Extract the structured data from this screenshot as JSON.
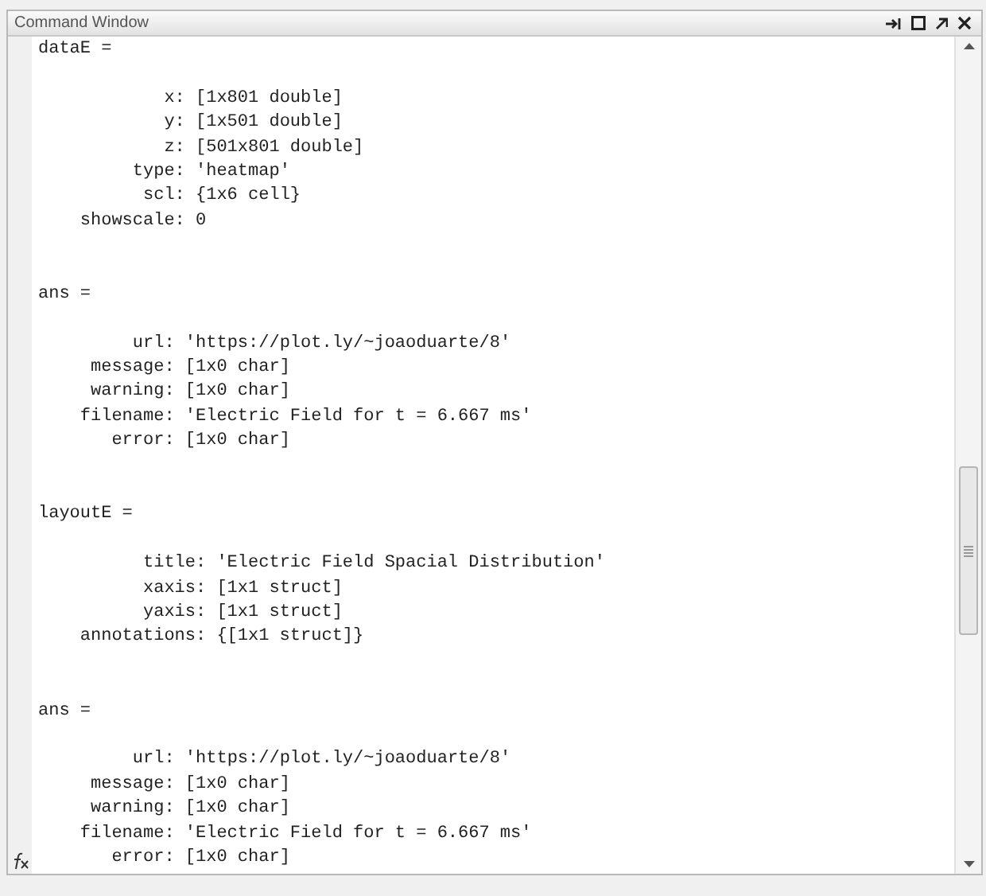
{
  "window": {
    "title": "Command Window"
  },
  "output": [
    {
      "variable": "dataE =",
      "fields": [
        {
          "name": "x:",
          "value": "[1x801 double]"
        },
        {
          "name": "y:",
          "value": "[1x501 double]"
        },
        {
          "name": "z:",
          "value": "[501x801 double]"
        },
        {
          "name": "type:",
          "value": "'heatmap'"
        },
        {
          "name": "scl:",
          "value": "{1x6 cell}"
        },
        {
          "name": "showscale:",
          "value": "0"
        }
      ]
    },
    {
      "variable": "ans =",
      "fields": [
        {
          "name": "url:",
          "value": "'https://plot.ly/~joaoduarte/8'"
        },
        {
          "name": "message:",
          "value": "[1x0 char]"
        },
        {
          "name": "warning:",
          "value": "[1x0 char]"
        },
        {
          "name": "filename:",
          "value": "'Electric Field for t = 6.667 ms'"
        },
        {
          "name": "error:",
          "value": "[1x0 char]"
        }
      ]
    },
    {
      "variable": "layoutE =",
      "fields": [
        {
          "name": "title:",
          "value": "'Electric Field Spacial Distribution'"
        },
        {
          "name": "xaxis:",
          "value": "[1x1 struct]"
        },
        {
          "name": "yaxis:",
          "value": "[1x1 struct]"
        },
        {
          "name": "annotations:",
          "value": "{[1x1 struct]}"
        }
      ]
    },
    {
      "variable": "ans =",
      "fields": [
        {
          "name": "url:",
          "value": "'https://plot.ly/~joaoduarte/8'"
        },
        {
          "name": "message:",
          "value": "[1x0 char]"
        },
        {
          "name": "warning:",
          "value": "[1x0 char]"
        },
        {
          "name": "filename:",
          "value": "'Electric Field for t = 6.667 ms'"
        },
        {
          "name": "error:",
          "value": "[1x0 char]"
        }
      ]
    }
  ]
}
